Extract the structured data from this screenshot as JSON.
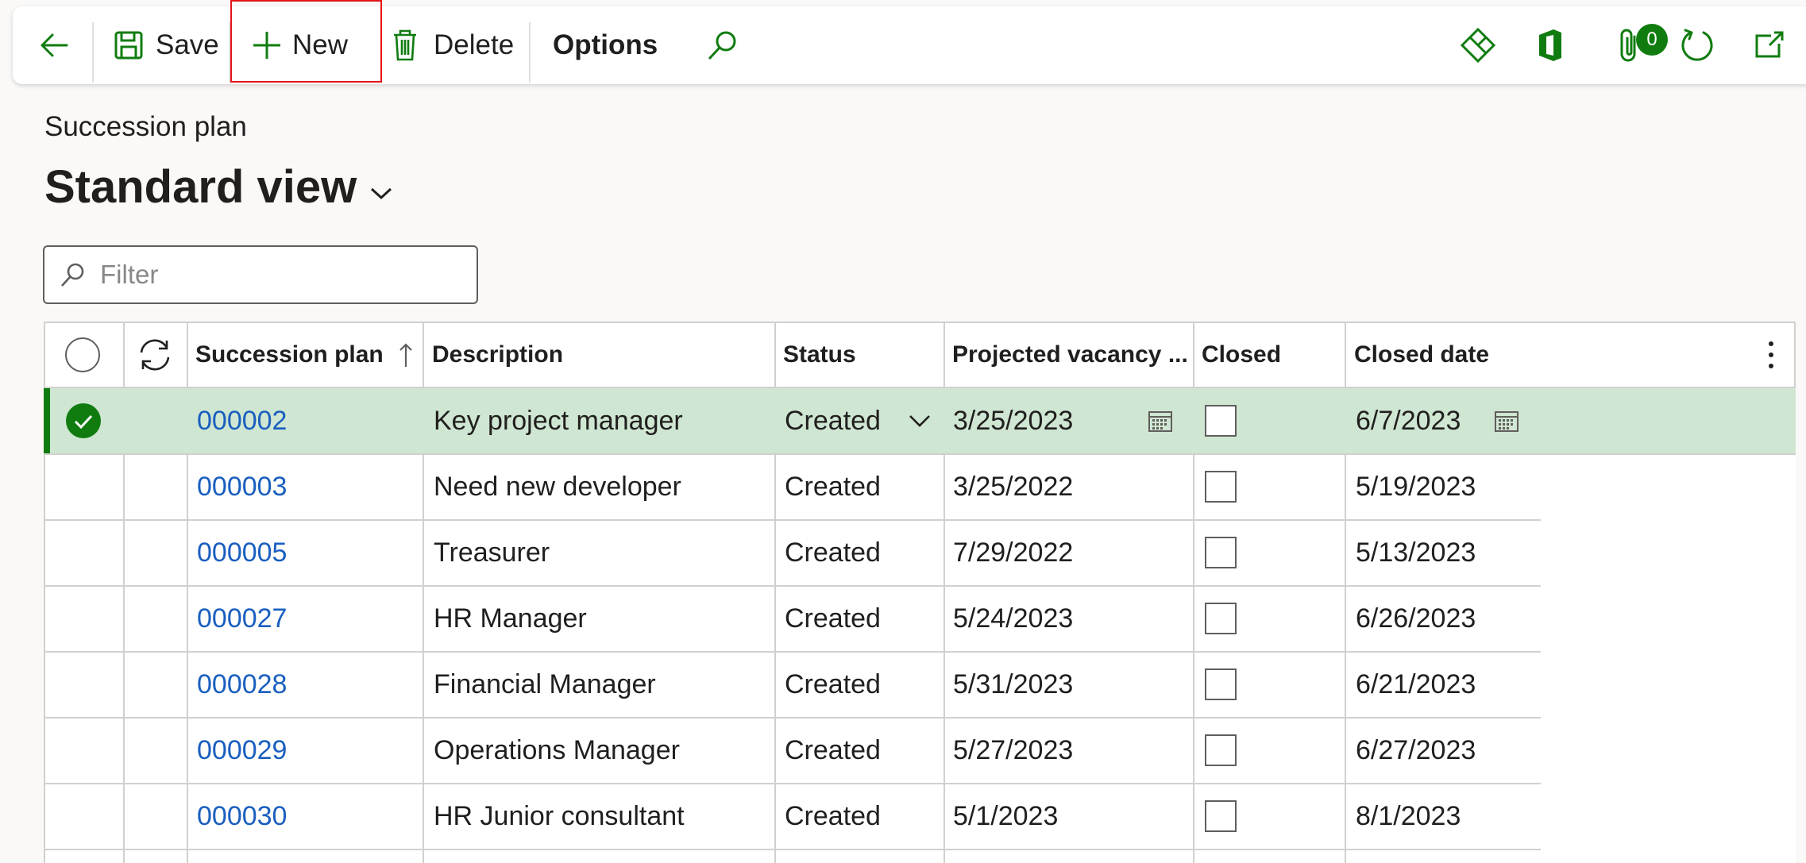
{
  "toolbar": {
    "save_label": "Save",
    "new_label": "New",
    "delete_label": "Delete",
    "options_label": "Options",
    "attachments_count": "0"
  },
  "page": {
    "breadcrumb": "Succession plan",
    "view_title": "Standard view"
  },
  "filter": {
    "placeholder": "Filter"
  },
  "grid": {
    "columns": [
      "Succession plan",
      "Description",
      "Status",
      "Projected vacancy ...",
      "Closed",
      "Closed date"
    ],
    "rows": [
      {
        "id": "000002",
        "description": "Key project manager",
        "status": "Created",
        "projected_vacancy": "3/25/2023",
        "closed": false,
        "closed_date": "6/7/2023"
      },
      {
        "id": "000003",
        "description": "Need new developer",
        "status": "Created",
        "projected_vacancy": "3/25/2022",
        "closed": false,
        "closed_date": "5/19/2023"
      },
      {
        "id": "000005",
        "description": "Treasurer",
        "status": "Created",
        "projected_vacancy": "7/29/2022",
        "closed": false,
        "closed_date": "5/13/2023"
      },
      {
        "id": "000027",
        "description": "HR Manager",
        "status": "Created",
        "projected_vacancy": "5/24/2023",
        "closed": false,
        "closed_date": "6/26/2023"
      },
      {
        "id": "000028",
        "description": "Financial Manager",
        "status": "Created",
        "projected_vacancy": "5/31/2023",
        "closed": false,
        "closed_date": "6/21/2023"
      },
      {
        "id": "000029",
        "description": "Operations Manager",
        "status": "Created",
        "projected_vacancy": "5/27/2023",
        "closed": false,
        "closed_date": "6/27/2023"
      },
      {
        "id": "000030",
        "description": "HR Junior consultant",
        "status": "Created",
        "projected_vacancy": "5/1/2023",
        "closed": false,
        "closed_date": "8/1/2023"
      }
    ]
  },
  "colors": {
    "accent": "#107c10",
    "link": "#1a5fbf",
    "selected_row": "#cfe6d2",
    "highlight": "#e3151a"
  }
}
